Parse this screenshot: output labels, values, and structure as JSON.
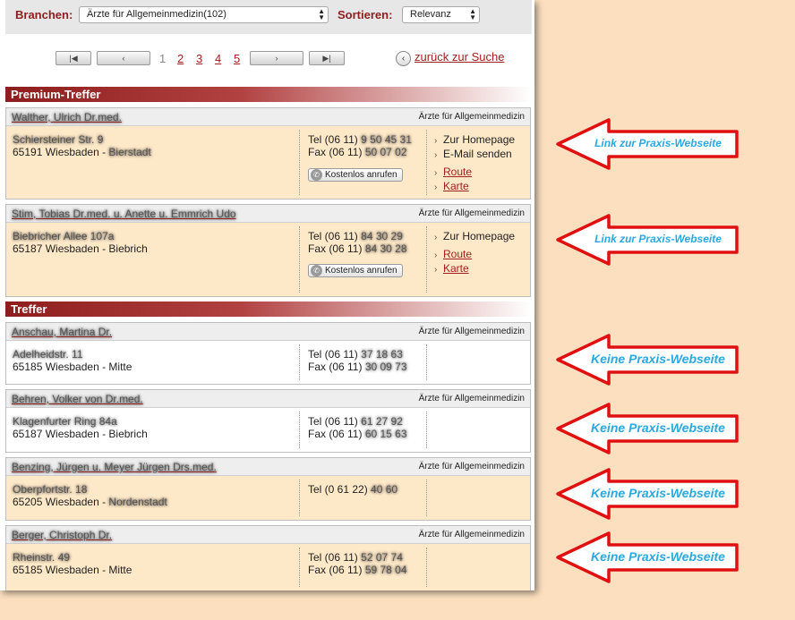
{
  "filters": {
    "branchen_label": "Branchen:",
    "branchen_value": "Ärzte für Allgemeinmedizin(102)",
    "sortieren_label": "Sortieren:",
    "sortieren_value": "Relevanz"
  },
  "pagination": {
    "current": "1",
    "pages": [
      "2",
      "3",
      "4",
      "5"
    ],
    "back_label": "zurück zur Suche"
  },
  "sections": {
    "premium": "Premium-Treffer",
    "treffer": "Treffer"
  },
  "cards": [
    {
      "name": "Walther, Ulrich Dr.med.",
      "category": "Ärzte für Allgemeinmedizin",
      "street": "Schiersteiner Str. 9",
      "city": "65191 Wiesbaden -",
      "district": "Bierstadt",
      "tel": "Tel (06 11)",
      "tel_num": "9 50 45 31",
      "fax": "Fax (06 11)",
      "fax_num": "50 07 02",
      "links": [
        "Zur Homepage",
        "E-Mail senden"
      ],
      "red_links": [
        "Route",
        "Karte"
      ],
      "call_label": "Kostenlos anrufen"
    },
    {
      "name": "Stim, Tobias Dr.med. u. Anette u. Emmrich Udo",
      "category": "Ärzte für Allgemeinmedizin",
      "street": "Biebricher Allee 107a",
      "city": "65187 Wiesbaden - Biebrich",
      "tel": "Tel (06 11)",
      "tel_num": "84 30 29",
      "fax": "Fax (06 11)",
      "fax_num": "84 30 28",
      "links": [
        "Zur Homepage"
      ],
      "red_links": [
        "Route",
        "Karte"
      ],
      "call_label": "Kostenlos anrufen"
    },
    {
      "name": "Anschau, Martina Dr.",
      "category": "Ärzte für Allgemeinmedizin",
      "street": "Adelheidstr. 11",
      "city": "65185 Wiesbaden - Mitte",
      "tel": "Tel (06 11)",
      "tel_num": "37 18 63",
      "fax": "Fax (06 11)",
      "fax_num": "30 09 73"
    },
    {
      "name": "Behren, Volker von Dr.med.",
      "category": "Ärzte für Allgemeinmedizin",
      "street": "Klagenfurter Ring 84a",
      "city": "65187 Wiesbaden - Biebrich",
      "tel": "Tel (06 11)",
      "tel_num": "61 27 92",
      "fax": "Fax (06 11)",
      "fax_num": "60 15 63"
    },
    {
      "name": "Benzing, Jürgen u. Meyer Jürgen Drs.med.",
      "category": "Ärzte für Allgemeinmedizin",
      "street": "Oberpfortstr. 18",
      "city": "65205 Wiesbaden -",
      "district": "Nordenstadt",
      "tel": "Tel (0 61 22)",
      "tel_num": "40 60"
    },
    {
      "name": "Berger, Christoph Dr.",
      "category": "Ärzte für Allgemeinmedizin",
      "street": "Rheinstr. 49",
      "city": "65185 Wiesbaden - Mitte",
      "tel": "Tel (06 11)",
      "tel_num": "52 07 74",
      "fax": "Fax (06 11)",
      "fax_num": "59 78 04"
    }
  ],
  "annotations": {
    "link": "Link zur Praxis-Webseite",
    "none": "Keine Praxis-Webseite"
  },
  "colors": {
    "accent": "#8e1e1e",
    "arrow_red": "#e01010",
    "callout_text": "#2aa9e0",
    "background": "#fbdfbf"
  }
}
